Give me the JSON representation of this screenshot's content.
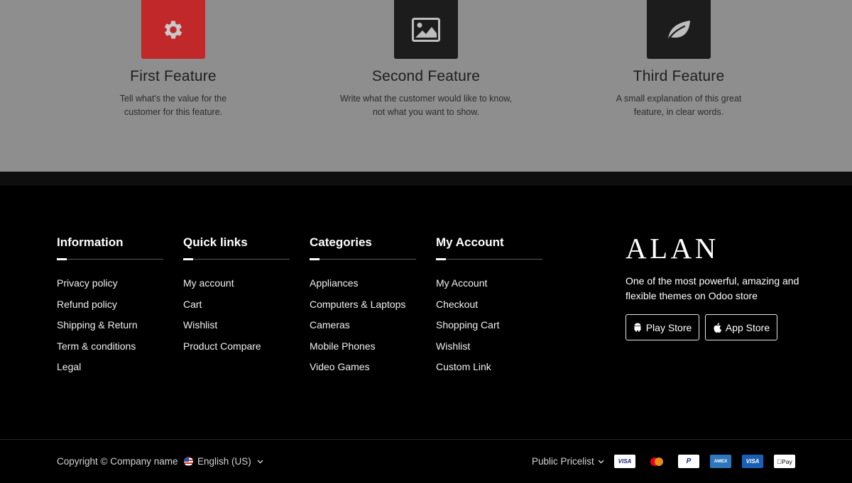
{
  "features": [
    {
      "title": "First Feature",
      "line1": "Tell what's the value for the",
      "line2": "customer for this feature.",
      "icon": "gear-icon",
      "tile_color": "#c0282a"
    },
    {
      "title": "Second Feature",
      "line1": "Write what the customer would like to know,",
      "line2": "not what you want to show.",
      "icon": "image-icon",
      "tile_color": "#1c1c1c"
    },
    {
      "title": "Third Feature",
      "line1": "A small explanation of this great",
      "line2": "feature, in clear words.",
      "icon": "leaf-icon",
      "tile_color": "#1c1c1c"
    }
  ],
  "footer": {
    "information": {
      "title": "Information",
      "items": [
        "Privacy policy",
        "Refund policy",
        "Shipping & Return",
        "Term & conditions",
        "Legal"
      ]
    },
    "quick_links": {
      "title": "Quick links",
      "items": [
        "My account",
        "Cart",
        "Wishlist",
        "Product Compare"
      ]
    },
    "categories": {
      "title": "Categories",
      "items": [
        "Appliances",
        "Computers & Laptops",
        "Cameras",
        "Mobile Phones",
        "Video Games"
      ]
    },
    "my_account": {
      "title": "My Account",
      "items": [
        "My Account",
        "Checkout",
        "Shopping Cart",
        "Wishlist",
        "Custom Link"
      ]
    },
    "brand": {
      "logo": "ALAN",
      "tagline": "One of the most powerful, amazing and flexible themes on Odoo store",
      "play_store": "Play Store",
      "app_store": "App Store"
    }
  },
  "bottom_bar": {
    "copyright": "Copyright © Company name",
    "language": "English (US)",
    "pricelist": "Public Pricelist",
    "payments": [
      {
        "name": "visa-icon",
        "label": "VISA",
        "bg": "#ffffff",
        "fg": "#1a1f71"
      },
      {
        "name": "mastercard-icon",
        "label": "",
        "bg": "#000000",
        "fg": "#ffffff"
      },
      {
        "name": "paypal-icon",
        "label": "P",
        "bg": "#ffffff",
        "fg": "#003087"
      },
      {
        "name": "amex-icon",
        "label": "AMEX",
        "bg": "#2e77bc",
        "fg": "#ffffff"
      },
      {
        "name": "visa-electron-icon",
        "label": "VISA",
        "bg": "#1a5fb4",
        "fg": "#ffffff"
      },
      {
        "name": "apple-pay-icon",
        "label": "Pay",
        "bg": "#ffffff",
        "fg": "#000000"
      }
    ]
  }
}
